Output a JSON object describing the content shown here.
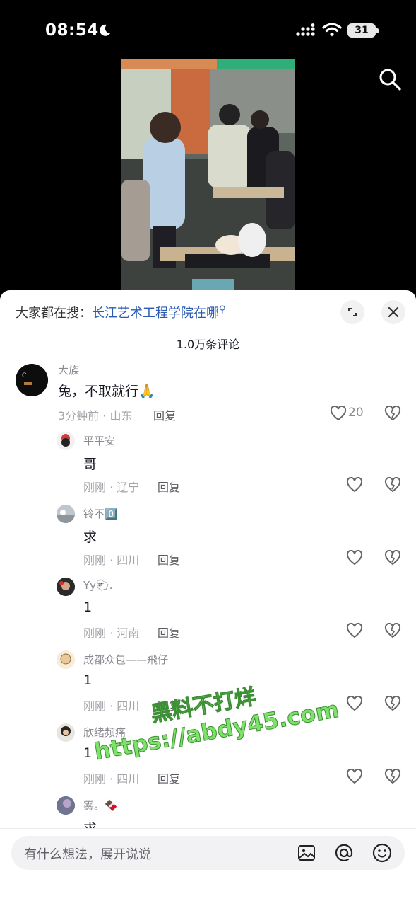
{
  "status": {
    "time": "08:54",
    "battery": "31"
  },
  "sheet": {
    "search_prefix": "大家都在搜：",
    "search_keyword": "长江艺术工程学院在哪",
    "comment_count": "1.0万条评论"
  },
  "comments": [
    {
      "name": "大族",
      "text": "兔，不取就行🙏",
      "time_loc": "3分钟前 · 山东",
      "reply": "回复",
      "likes": "20"
    },
    {
      "name": "平平安",
      "text": "哥",
      "time_loc": "刚刚 · 辽宁",
      "reply": "回复"
    },
    {
      "name": "铃不0️⃣",
      "text": "求",
      "time_loc": "刚刚 · 四川",
      "reply": "回复"
    },
    {
      "name": "Yy🐑.",
      "text": "1",
      "time_loc": "刚刚 · 河南",
      "reply": "回复"
    },
    {
      "name": "成都众包——飛仔",
      "text": "1",
      "time_loc": "刚刚 · 四川",
      "reply": "回复"
    },
    {
      "name": "欣绪频痛",
      "text": "1",
      "time_loc": "刚刚 · 四川",
      "reply": "回复"
    },
    {
      "name": "雾。🍫",
      "text": "求"
    }
  ],
  "watermark": {
    "line1": "黑料不打烊",
    "line2": "https://abdy45.com"
  },
  "input": {
    "placeholder": "有什么想法，展开说说"
  }
}
